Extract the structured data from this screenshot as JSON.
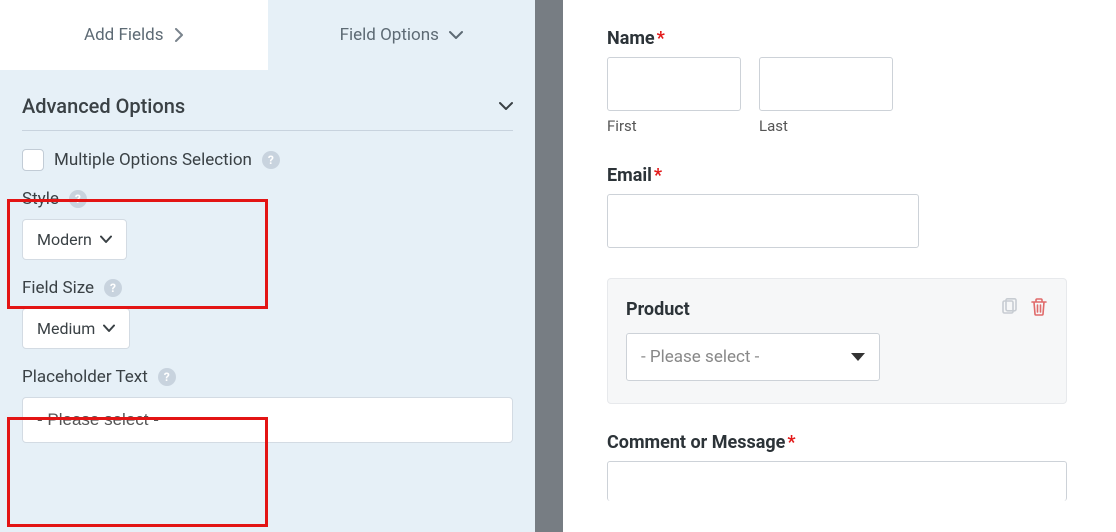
{
  "tabs": {
    "add_fields": "Add Fields",
    "field_options": "Field Options"
  },
  "section": {
    "advanced_options": "Advanced Options"
  },
  "options": {
    "multiple_selection": "Multiple Options Selection",
    "style": {
      "label": "Style",
      "value": "Modern"
    },
    "field_size": {
      "label": "Field Size",
      "value": "Medium"
    },
    "placeholder_text": {
      "label": "Placeholder Text",
      "value": "- Please select -"
    }
  },
  "preview": {
    "name": {
      "label": "Name",
      "first": "First",
      "last": "Last"
    },
    "email": {
      "label": "Email"
    },
    "product": {
      "label": "Product",
      "placeholder": "- Please select -"
    },
    "comment": {
      "label": "Comment or Message"
    }
  }
}
